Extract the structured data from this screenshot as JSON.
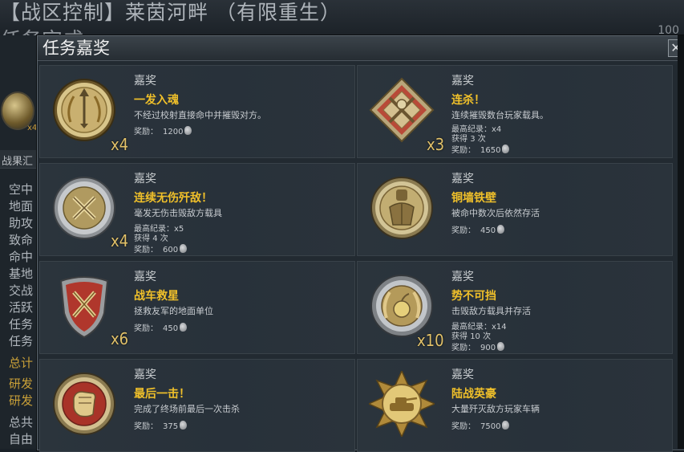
{
  "background": {
    "title": "【战区控制】莱茵河畔 （有限重生）",
    "subtitle": "任务完成",
    "medal_mult": "x4",
    "bar_label": "战果汇",
    "list_items": [
      "空中",
      "地面",
      "助攻",
      "致命",
      "命中",
      "基地",
      "交战",
      "活跃",
      "任务",
      "任务"
    ],
    "gold_items": [
      "总计",
      "研发",
      "研发"
    ],
    "bottom_items": [
      "总共",
      "自由"
    ],
    "topright": "100"
  },
  "dialog": {
    "title": "任务嘉奖",
    "close_label": "✕"
  },
  "labels": {
    "reward_heading": "嘉奖",
    "record": "最高纪录：",
    "earned": "获得",
    "times": "次",
    "prize": "奖励："
  },
  "awards": [
    {
      "name": "一发入魂",
      "desc": "不经过校射直接命中并摧毁对方。",
      "multiplier": "x4",
      "record": null,
      "earned": null,
      "prize": "1200",
      "emblem": "arrow-wreath-gold-icon"
    },
    {
      "name": "连杀！",
      "desc": "连续摧毁数台玩家载具。",
      "multiplier": "x3",
      "record": "x4",
      "earned": "3",
      "prize": "1650",
      "emblem": "crossed-swords-diamond-icon"
    },
    {
      "name": "连续无伤歼敌！",
      "desc": "毫发无伤击毁敌方载具",
      "multiplier": "x4",
      "record": "x5",
      "earned": "4",
      "prize": "600",
      "emblem": "crossed-swords-silver-icon"
    },
    {
      "name": "铜墙铁壁",
      "desc": "被命中数次后依然存活",
      "multiplier": "",
      "record": null,
      "earned": null,
      "prize": "450",
      "emblem": "knight-armor-icon"
    },
    {
      "name": "战车救星",
      "desc": "拯救友军的地面单位",
      "multiplier": "x6",
      "record": null,
      "earned": null,
      "prize": "450",
      "emblem": "red-shield-swords-icon"
    },
    {
      "name": "势不可挡",
      "desc": "击毁敌方载具并存活",
      "multiplier": "x10",
      "record": "x14",
      "earned": "10",
      "prize": "900",
      "emblem": "bomb-wreath-icon"
    },
    {
      "name": "最后一击！",
      "desc": "完成了终场前最后一次击杀",
      "multiplier": "",
      "record": null,
      "earned": null,
      "prize": "375",
      "emblem": "red-fist-icon"
    },
    {
      "name": "陆战英豪",
      "desc": "大量歼灭敌方玩家车辆",
      "multiplier": "",
      "record": null,
      "earned": null,
      "prize": "7500",
      "emblem": "tank-star-gold-icon"
    }
  ],
  "colors": {
    "accent_gold": "#f0c02a",
    "multiplier_gold": "#e2c26a",
    "card_bg": "#2b343c"
  }
}
